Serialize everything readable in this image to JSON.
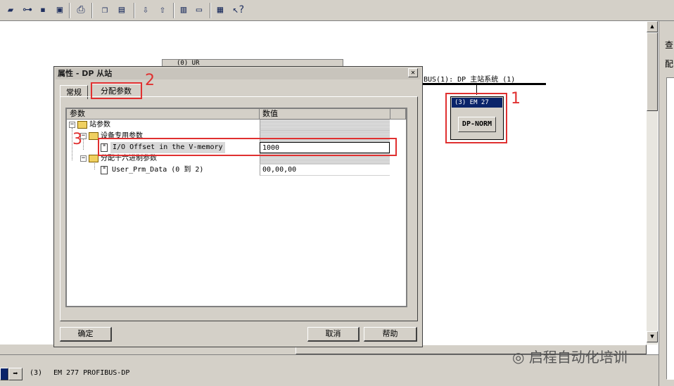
{
  "toolbar": {
    "icons": [
      "open-icon",
      "network-icon",
      "save-icon",
      "save-download-icon",
      "print-icon",
      "copy-icon",
      "paste-icon",
      "download-icon",
      "upload-icon",
      "catalog-icon",
      "window-icon",
      "config-icon",
      "help-pointer-icon"
    ]
  },
  "network": {
    "bus_label": "BUS(1): DP 主站系统 (1)",
    "station_title": "(3) EM 27",
    "station_module": "DP-NORM"
  },
  "background_window": {
    "title": "(0) UR"
  },
  "right_panel": {
    "labels": [
      "查",
      "配"
    ]
  },
  "dialog": {
    "title": "属性 - DP 从站",
    "close": "✕",
    "tabs": {
      "general": "常规",
      "params": "分配参数"
    },
    "grid": {
      "col_param": "参数",
      "col_value": "数值",
      "rows": [
        {
          "name": "站参数",
          "value": ""
        },
        {
          "name": "设备专用参数",
          "value": ""
        },
        {
          "name": "I/O Offset in the V-memory",
          "value": "1000"
        },
        {
          "name": "分配十六进制参数",
          "value": ""
        },
        {
          "name": "User_Prm_Data (0 到 2)",
          "value": "00,00,00"
        }
      ]
    },
    "buttons": {
      "ok": "确定",
      "cancel": "取消",
      "help": "帮助"
    }
  },
  "annotations": {
    "n1": "1",
    "n2": "2",
    "n3": "3"
  },
  "status": {
    "slot": "(3)",
    "module": "EM 277 PROFIBUS-DP"
  },
  "watermark": "启程自动化培训"
}
